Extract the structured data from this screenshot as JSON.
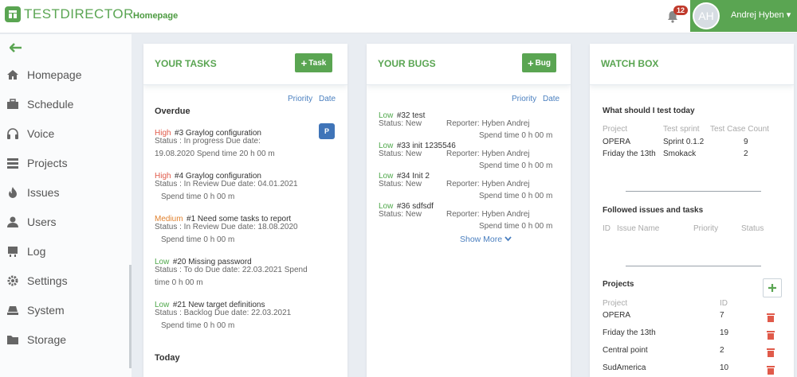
{
  "header": {
    "logo_text": "TESTDIRECTOR",
    "breadcrumb": "Homepage",
    "notification_count": "12",
    "avatar_initials": "AH",
    "user_name": "Andrej Hyben ▾"
  },
  "sidebar": {
    "items": [
      {
        "label": "Homepage",
        "icon": "home-icon"
      },
      {
        "label": "Schedule",
        "icon": "briefcase-icon"
      },
      {
        "label": "Voice",
        "icon": "headphones-icon"
      },
      {
        "label": "Projects",
        "icon": "list-icon"
      },
      {
        "label": "Issues",
        "icon": "fire-icon"
      },
      {
        "label": "Users",
        "icon": "user-icon"
      },
      {
        "label": "Log",
        "icon": "log-icon"
      },
      {
        "label": "Settings",
        "icon": "gear-icon"
      },
      {
        "label": "System",
        "icon": "system-icon"
      },
      {
        "label": "Storage",
        "icon": "folder-icon"
      }
    ]
  },
  "tasks": {
    "title": "YOUR TASKS",
    "add_label": "Task",
    "sort": {
      "priority": "Priority",
      "date": "Date"
    },
    "overdue_label": "Overdue",
    "today_label": "Today",
    "items": [
      {
        "priority": "High",
        "name": "#3 Graylog configuration",
        "line1": "Status : In progress   Due date:",
        "line2": "19.08.2020   Spend time 20 h 00 m",
        "badge": "P"
      },
      {
        "priority": "High",
        "name": "#4 Graylog configuration",
        "line1": "Status : In Review   Due date: 04.01.2021",
        "line2": "Spend time 0 h 00 m"
      },
      {
        "priority": "Medium",
        "name": "#1 Need some tasks to report",
        "line1": "Status : In Review   Due date: 18.08.2020",
        "line2": "Spend time 0 h 00 m"
      },
      {
        "priority": "Low",
        "name": "#20 Missing password",
        "line1": "Status : To do   Due date: 22.03.2021   Spend",
        "line2": "time 0 h 00 m"
      },
      {
        "priority": "Low",
        "name": "#21 New target definitions",
        "line1": "Status : Backlog   Due date: 22.03.2021",
        "line2": "Spend time 0 h 00 m"
      }
    ]
  },
  "bugs": {
    "title": "YOUR BUGS",
    "add_label": "Bug",
    "sort": {
      "priority": "Priority",
      "date": "Date"
    },
    "items": [
      {
        "priority": "Low",
        "name": "#32 test",
        "status": "Status: New",
        "reporter": "Reporter: Hyben Andrej",
        "spend": "Spend time 0 h 00 m"
      },
      {
        "priority": "Low",
        "name": "#33 init 1235546",
        "status": "Status: New",
        "reporter": "Reporter: Hyben Andrej",
        "spend": "Spend time 0 h 00 m"
      },
      {
        "priority": "Low",
        "name": "#34 Init 2",
        "status": "Status: New",
        "reporter": "Reporter: Hyben Andrej",
        "spend": "Spend time 0 h 00 m"
      },
      {
        "priority": "Low",
        "name": "#36 sdfsdf",
        "status": "Status: New",
        "reporter": "Reporter: Hyben Andrej",
        "spend": "Spend time 0 h 00 m"
      }
    ],
    "show_more": "Show More"
  },
  "watch": {
    "title": "WATCH BOX",
    "test_today": {
      "heading": "What should I test today",
      "columns": [
        "Project",
        "Test sprint",
        "Test Case Count"
      ],
      "rows": [
        [
          "OPERA",
          "Sprint 0.1.2",
          "9"
        ],
        [
          "Friday the 13th",
          "Smokack",
          "2"
        ]
      ]
    },
    "followed": {
      "heading": "Followed issues and tasks",
      "columns": [
        "ID",
        "Issue Name",
        "Priority",
        "Status"
      ]
    },
    "projects": {
      "heading": "Projects",
      "columns": [
        "Project",
        "ID"
      ],
      "rows": [
        [
          "OPERA",
          "7"
        ],
        [
          "Friday the 13th",
          "19"
        ],
        [
          "Central point",
          "2"
        ],
        [
          "SudAmerica",
          "10"
        ]
      ]
    }
  },
  "colors": {
    "accent": "#5aa552",
    "high": "#e05a4a",
    "medium": "#e0822f",
    "low": "#4fa84a",
    "link": "#4a7fbf"
  }
}
